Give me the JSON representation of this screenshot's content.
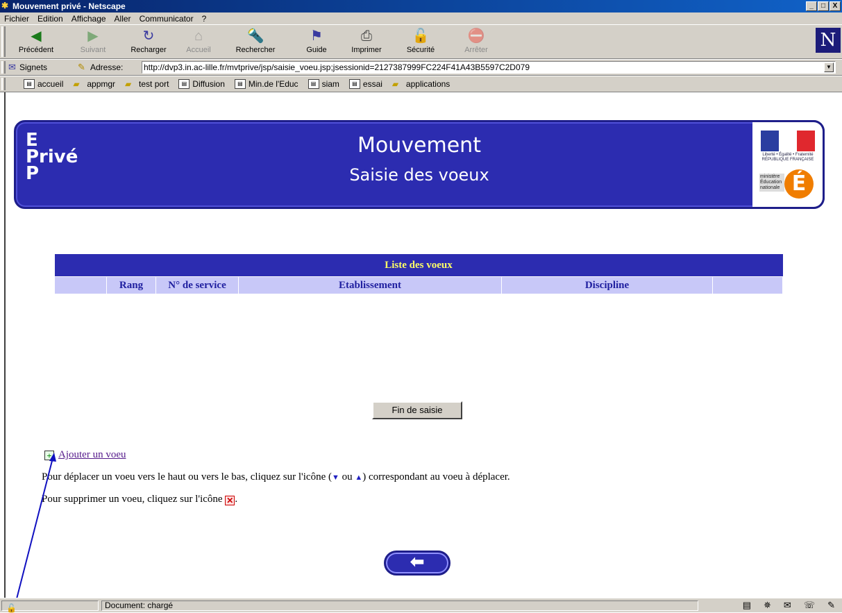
{
  "window": {
    "title": "Mouvement privé - Netscape",
    "min": "_",
    "max": "□",
    "close": "X"
  },
  "menu": [
    "Fichier",
    "Edition",
    "Affichage",
    "Aller",
    "Communicator",
    "?"
  ],
  "toolbar": [
    {
      "label": "Précédent",
      "icon": "back-arrow-icon",
      "enabled": true
    },
    {
      "label": "Suivant",
      "icon": "forward-arrow-icon",
      "enabled": false
    },
    {
      "label": "Recharger",
      "icon": "reload-icon",
      "enabled": true
    },
    {
      "label": "Accueil",
      "icon": "home-icon",
      "enabled": false
    },
    {
      "label": "Rechercher",
      "icon": "search-icon",
      "enabled": true
    },
    {
      "label": "Guide",
      "icon": "guide-icon",
      "enabled": true
    },
    {
      "label": "Imprimer",
      "icon": "print-icon",
      "enabled": true
    },
    {
      "label": "Sécurité",
      "icon": "lock-icon",
      "enabled": true
    },
    {
      "label": "Arrêter",
      "icon": "stop-icon",
      "enabled": false
    }
  ],
  "brand_letter": "N",
  "location": {
    "signets": "Signets",
    "adresse": "Adresse:",
    "url": "http://dvp3.in.ac-lille.fr/mvtprive/jsp/saisie_voeu.jsp;jsessionid=2127387999FC224F41A43B5597C2D079"
  },
  "personal": [
    {
      "label": "accueil",
      "kind": "page"
    },
    {
      "label": "appmgr",
      "kind": "folder"
    },
    {
      "label": "test port",
      "kind": "folder"
    },
    {
      "label": "Diffusion",
      "kind": "page"
    },
    {
      "label": "Min.de l'Educ",
      "kind": "page"
    },
    {
      "label": "siam",
      "kind": "page"
    },
    {
      "label": "essai",
      "kind": "page"
    },
    {
      "label": "applications",
      "kind": "folder"
    }
  ],
  "banner": {
    "logo_lines": [
      "E",
      "Privé",
      "P"
    ],
    "title": "Mouvement",
    "subtitle": "Saisie des voeux",
    "republique": "Liberté • Égalité • Fraternité RÉPUBLIQUE FRANÇAISE",
    "ministere": "ministère Éducation nationale",
    "e_letter": "É"
  },
  "table": {
    "caption": "Liste des voeux",
    "headers": [
      "",
      "Rang",
      "N° de service",
      "Etablissement",
      "Discipline",
      ""
    ]
  },
  "fin_button": "Fin de saisie",
  "add_link": "Ajouter un voeu",
  "info": {
    "move_a": "Pour déplacer un voeu vers le haut ou vers le bas, cliquez sur l'icône (",
    "down": "▼",
    "ou": " ou ",
    "up": "▲",
    "move_b": ") correspondant au voeu à déplacer.",
    "delete_a": "Pour supprimer un voeu, cliquez sur l'icône ",
    "delete_b": "."
  },
  "back_button": "⬅",
  "status": {
    "text": "Document: chargé"
  },
  "colors": {
    "banner": "#2c2cb0",
    "caption_text": "#ffff66",
    "header_bg": "#c8c8f8",
    "link": "#551a8b"
  }
}
